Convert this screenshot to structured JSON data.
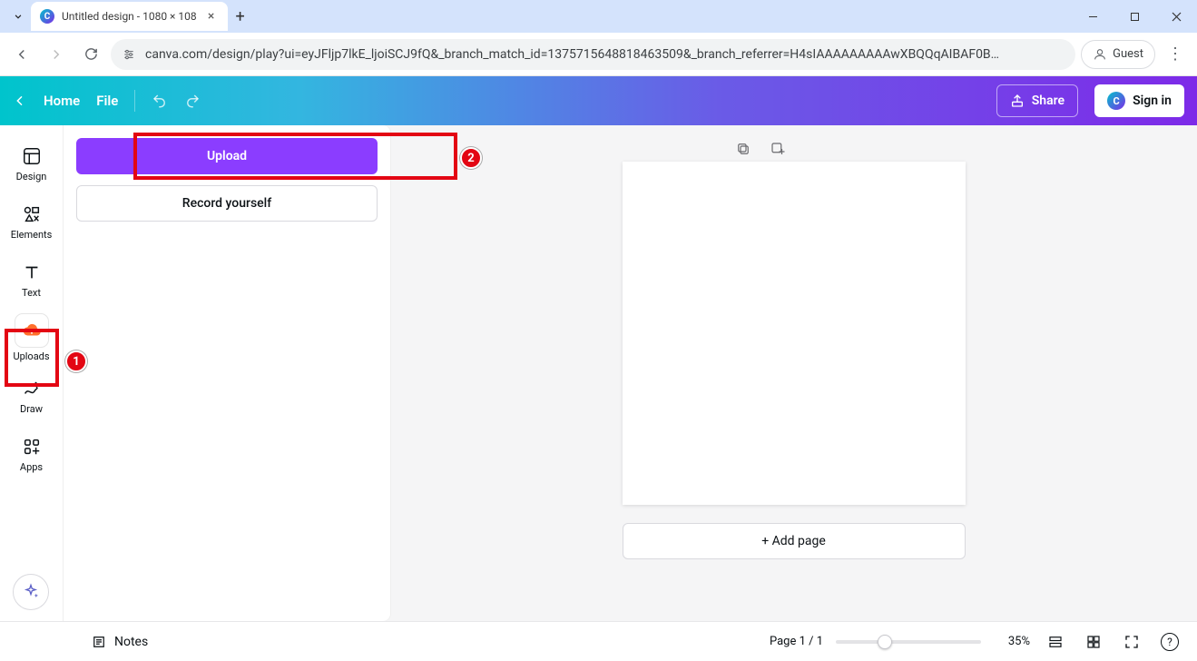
{
  "browser": {
    "tab_title": "Untitled design - 1080 × 108",
    "url": "canva.com/design/play?ui=eyJFljp7lkE_ljoiSCJ9fQ&_branch_match_id=1375715648818463509&_branch_referrer=H4sIAAAAAAAAAwXBQQqAIBAF0B…",
    "guest_label": "Guest"
  },
  "header": {
    "home": "Home",
    "file": "File",
    "share": "Share",
    "signin": "Sign in"
  },
  "rail": {
    "items": [
      {
        "id": "design",
        "label": "Design"
      },
      {
        "id": "elements",
        "label": "Elements"
      },
      {
        "id": "text",
        "label": "Text"
      },
      {
        "id": "uploads",
        "label": "Uploads"
      },
      {
        "id": "draw",
        "label": "Draw"
      },
      {
        "id": "apps",
        "label": "Apps"
      }
    ]
  },
  "panel": {
    "upload_label": "Upload",
    "record_label": "Record yourself"
  },
  "canvas": {
    "add_page": "+ Add page"
  },
  "bottom": {
    "notes": "Notes",
    "page_indicator": "Page 1 / 1",
    "zoom_pct": "35%"
  },
  "annotations": {
    "badge1": "1",
    "badge2": "2"
  }
}
